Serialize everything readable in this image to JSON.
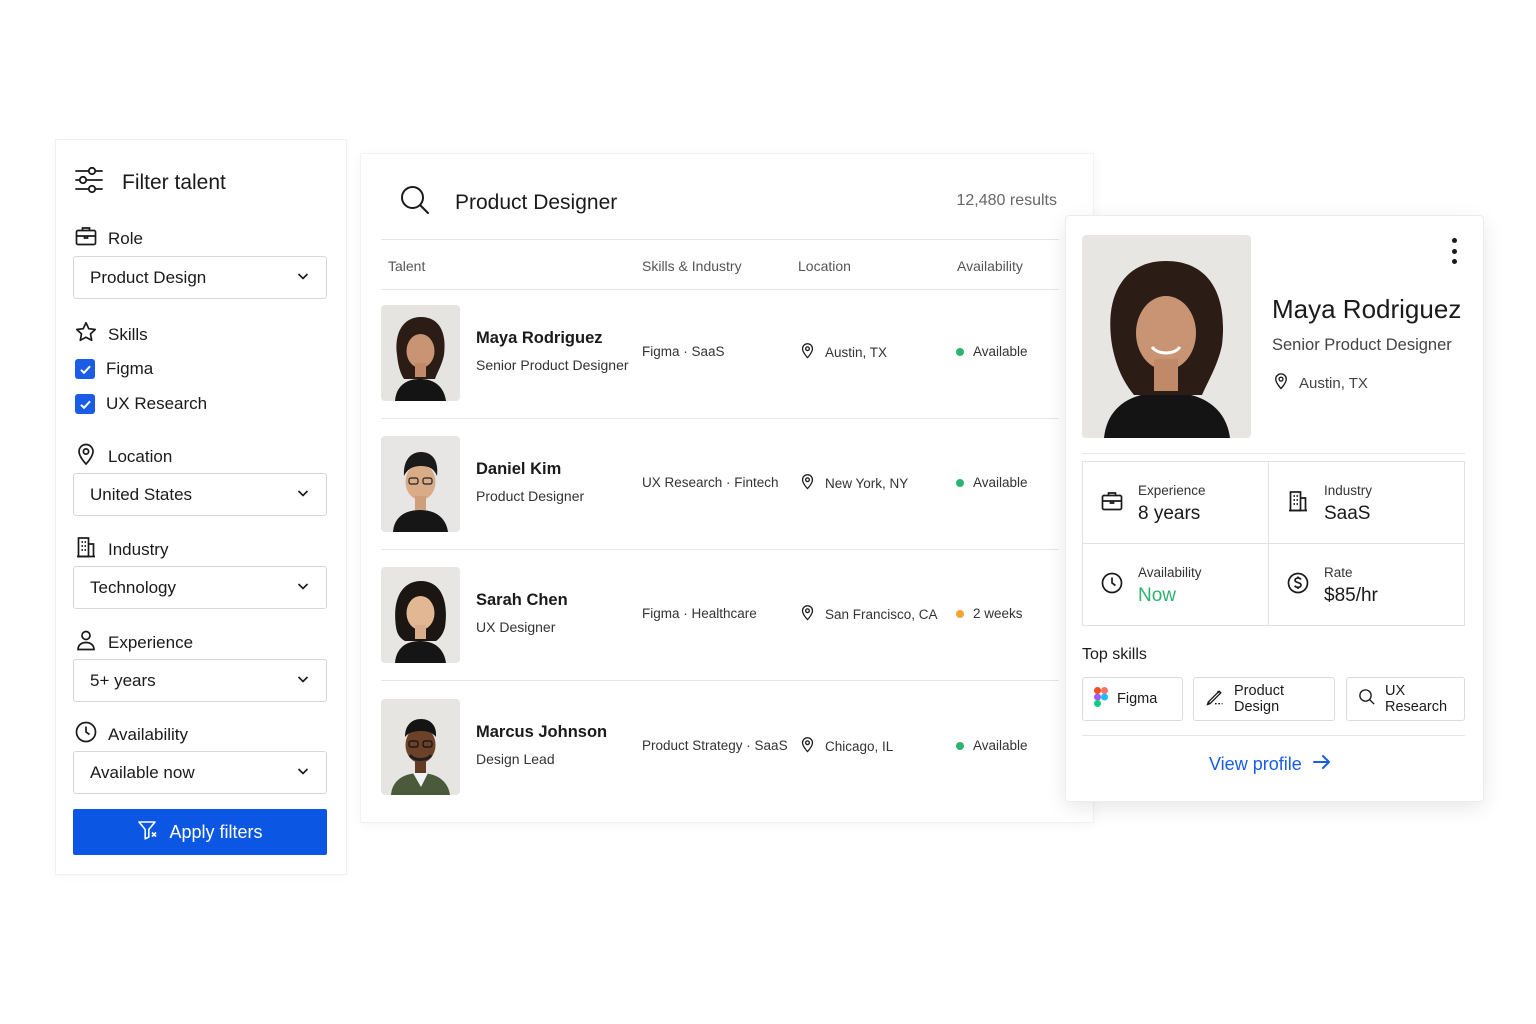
{
  "filters": {
    "title": "Filter talent",
    "role": {
      "label": "Role",
      "value": "Product Design"
    },
    "skills": {
      "label": "Skills",
      "items": [
        {
          "label": "Figma",
          "checked": true
        },
        {
          "label": "UX Research",
          "checked": true
        }
      ]
    },
    "location": {
      "label": "Location",
      "value": "United States"
    },
    "industry": {
      "label": "Industry",
      "value": "Technology"
    },
    "experience": {
      "label": "Experience",
      "value": "5+ years"
    },
    "availability": {
      "label": "Availability",
      "value": "Available now"
    },
    "apply_label": "Apply filters"
  },
  "results": {
    "query": "Product Designer",
    "count": "12,480 results",
    "columns": [
      "Talent",
      "Skills & Industry",
      "Location",
      "Availability"
    ],
    "rows": [
      {
        "name": "Maya Rodriguez",
        "role": "Senior Product Designer",
        "skills": "Figma  ·  SaaS",
        "location": "Austin, TX",
        "availability": "Available",
        "status_color": "#2db36f"
      },
      {
        "name": "Daniel Kim",
        "role": "Product Designer",
        "skills": "UX Research · Fintech",
        "location": "New York, NY",
        "availability": "Available",
        "status_color": "#2db36f"
      },
      {
        "name": "Sarah Chen",
        "role": "UX Designer",
        "skills": "Figma · Healthcare",
        "location": "San Francisco, CA",
        "availability": "2 weeks",
        "status_color": "#f5a23a"
      },
      {
        "name": "Marcus Johnson",
        "role": "Design Lead",
        "skills": "Product Strategy · SaaS",
        "location": "Chicago, IL",
        "availability": "Available",
        "status_color": "#2db36f"
      }
    ]
  },
  "profile": {
    "name": "Maya Rodriguez",
    "title": "Senior Product Designer",
    "location": "Austin, TX",
    "stats": {
      "experience": {
        "label": "Experience",
        "value": "8 years"
      },
      "industry": {
        "label": "Industry",
        "value": "SaaS"
      },
      "availability": {
        "label": "Availability",
        "value": "Now"
      },
      "rate": {
        "label": "Rate",
        "value": "$85/hr"
      }
    },
    "top_skills_label": "Top skills",
    "skills": [
      "Figma",
      "Product Design",
      "UX Research"
    ],
    "view_profile": "View profile"
  },
  "colors": {
    "accent": "#0b57e3",
    "link": "#1a5ce6",
    "available": "#2db36f",
    "soon": "#f5a23a"
  }
}
